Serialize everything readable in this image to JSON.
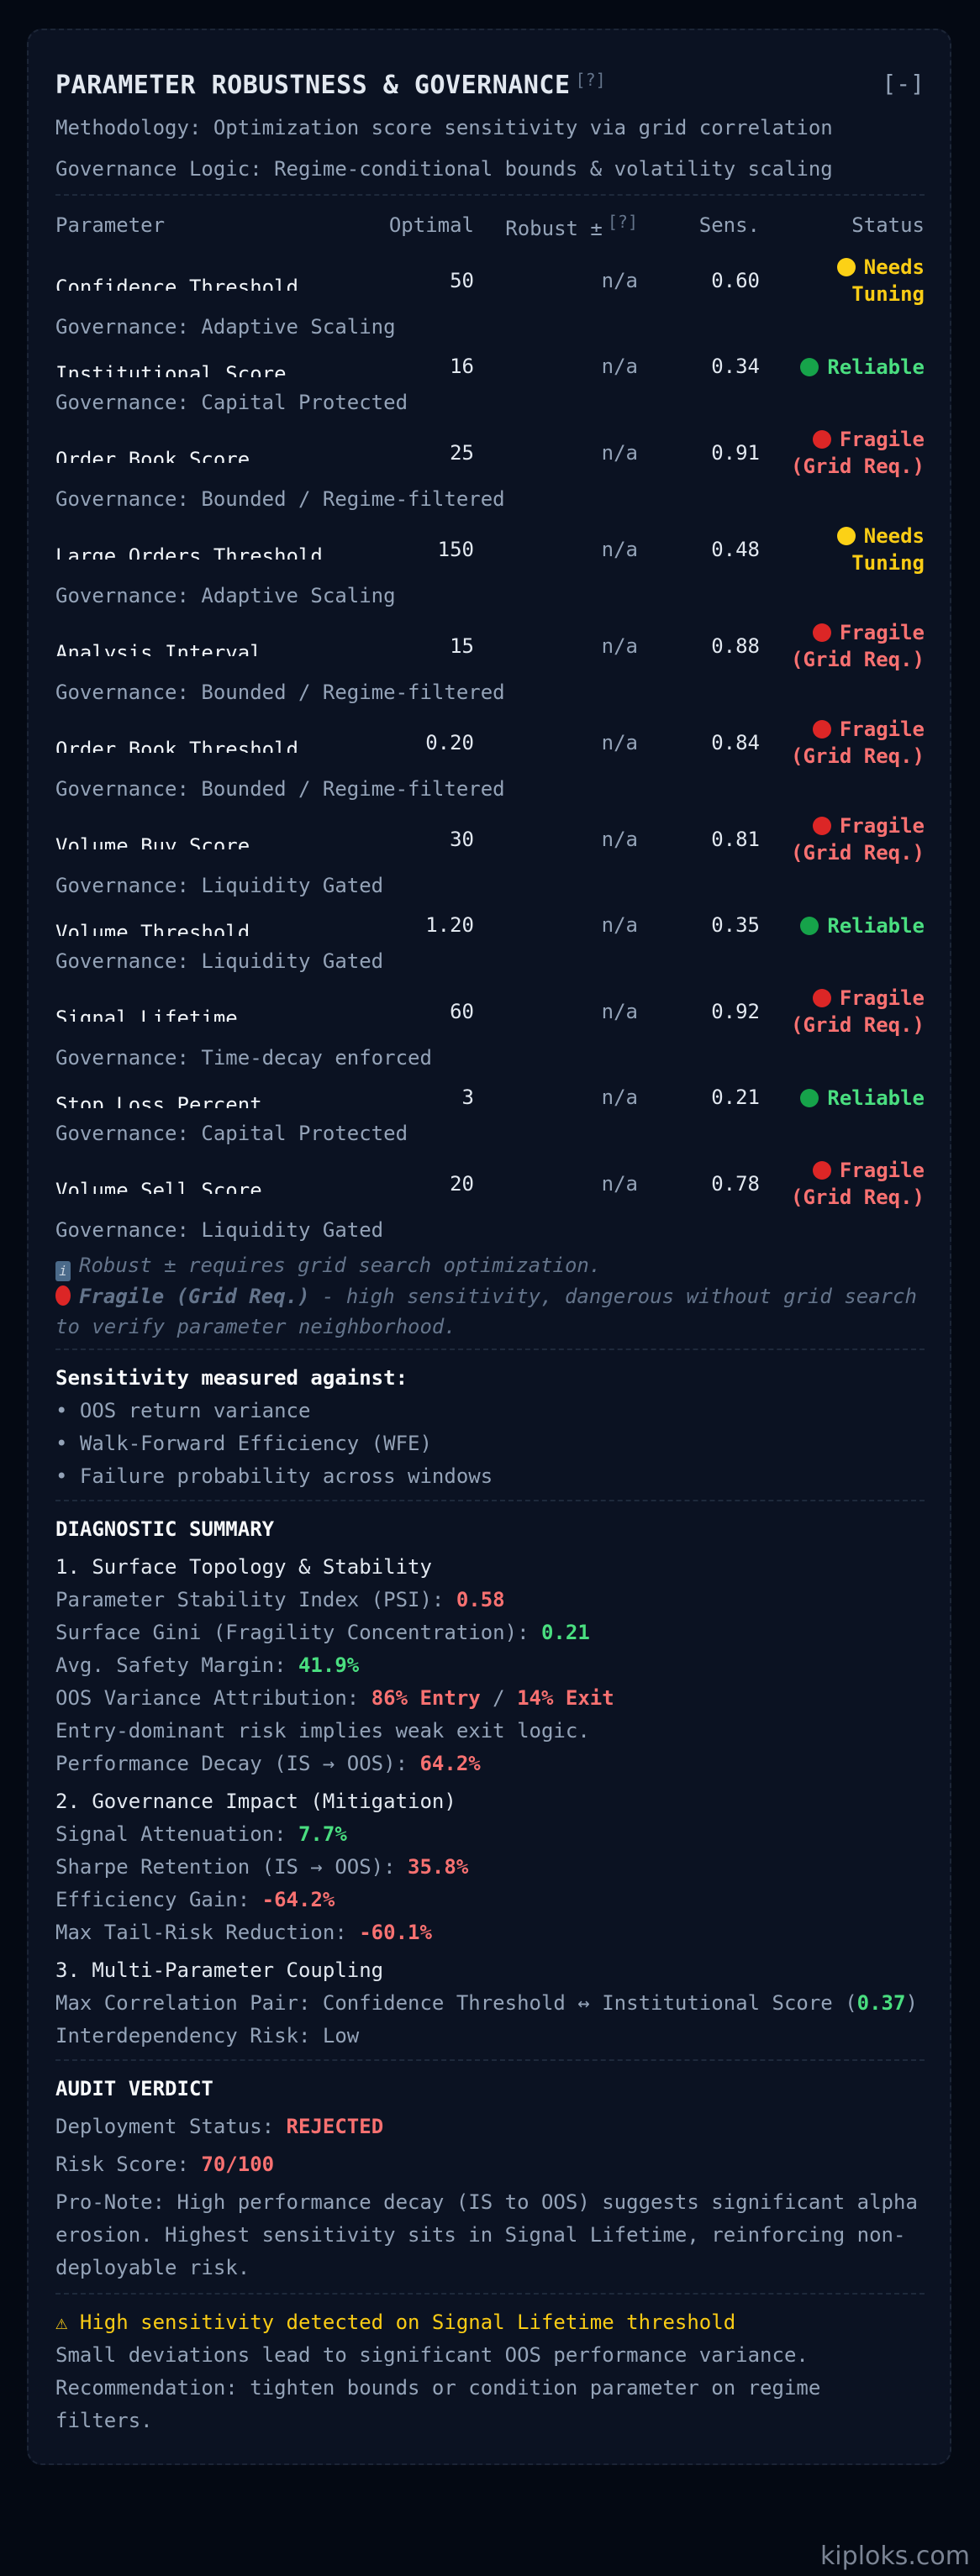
{
  "header": {
    "title": "PARAMETER ROBUSTNESS & GOVERNANCE",
    "help": "[?]",
    "collapse": "[-]"
  },
  "methodology": "Methodology: Optimization score sensitivity via grid correlation",
  "governance_logic": "Governance Logic: Regime-conditional bounds & volatility scaling",
  "table": {
    "headers": {
      "parameter": "Parameter",
      "optimal": "Optimal",
      "robust": "Robust ±",
      "robust_help": "[?]",
      "sens": "Sens.",
      "status": "Status"
    },
    "rows": [
      {
        "name": "Confidence Threshold",
        "optimal": "50",
        "robust": "n/a",
        "sens": "0.60",
        "status": "Needs Tuning",
        "level": "yellow",
        "governance": "Governance: Adaptive Scaling"
      },
      {
        "name": "Institutional Score",
        "optimal": "16",
        "robust": "n/a",
        "sens": "0.34",
        "status": "Reliable",
        "level": "green",
        "governance": "Governance: Capital Protected"
      },
      {
        "name": "Order Book Score",
        "optimal": "25",
        "robust": "n/a",
        "sens": "0.91",
        "status": "Fragile (Grid Req.)",
        "level": "red",
        "governance": "Governance: Bounded / Regime-filtered"
      },
      {
        "name": "Large Orders Threshold",
        "optimal": "150",
        "robust": "n/a",
        "sens": "0.48",
        "status": "Needs Tuning",
        "level": "yellow",
        "governance": "Governance: Adaptive Scaling"
      },
      {
        "name": "Analysis Interval",
        "optimal": "15",
        "robust": "n/a",
        "sens": "0.88",
        "status": "Fragile (Grid Req.)",
        "level": "red",
        "governance": "Governance: Bounded / Regime-filtered"
      },
      {
        "name": "Order Book Threshold",
        "optimal": "0.20",
        "robust": "n/a",
        "sens": "0.84",
        "status": "Fragile (Grid Req.)",
        "level": "red",
        "governance": "Governance: Bounded / Regime-filtered"
      },
      {
        "name": "Volume Buy Score",
        "optimal": "30",
        "robust": "n/a",
        "sens": "0.81",
        "status": "Fragile (Grid Req.)",
        "level": "red",
        "governance": "Governance: Liquidity Gated"
      },
      {
        "name": "Volume Threshold",
        "optimal": "1.20",
        "robust": "n/a",
        "sens": "0.35",
        "status": "Reliable",
        "level": "green",
        "governance": "Governance: Liquidity Gated"
      },
      {
        "name": "Signal Lifetime",
        "optimal": "60",
        "robust": "n/a",
        "sens": "0.92",
        "status": "Fragile (Grid Req.)",
        "level": "red",
        "governance": "Governance: Time-decay enforced"
      },
      {
        "name": "Stop Loss Percent",
        "optimal": "3",
        "robust": "n/a",
        "sens": "0.21",
        "status": "Reliable",
        "level": "green",
        "governance": "Governance: Capital Protected"
      },
      {
        "name": "Volume Sell Score",
        "optimal": "20",
        "robust": "n/a",
        "sens": "0.78",
        "status": "Fragile (Grid Req.)",
        "level": "red",
        "governance": "Governance: Liquidity Gated"
      }
    ]
  },
  "footnotes": {
    "robust_note": "Robust ± requires grid search optimization.",
    "fragile_label": "Fragile (Grid Req.)",
    "fragile_note": " - high sensitivity, dangerous without grid search to verify parameter neighborhood."
  },
  "sensitivity": {
    "title": "Sensitivity measured against:",
    "items": [
      "• OOS return variance",
      "• Walk-Forward Efficiency (WFE)",
      "• Failure probability across windows"
    ]
  },
  "diagnostic": {
    "title": "DIAGNOSTIC SUMMARY",
    "s1": {
      "title": "1. Surface Topology & Stability",
      "psi_label": "Parameter Stability Index (PSI): ",
      "psi": "0.58",
      "gini_label": "Surface Gini (Fragility Concentration): ",
      "gini": "0.21",
      "margin_label": "Avg. Safety Margin: ",
      "margin": "41.9%",
      "oos_label": "OOS Variance Attribution: ",
      "entry": "86% Entry",
      "sep": " / ",
      "exit": "14% Exit",
      "entry_note": "Entry-dominant risk implies weak exit logic.",
      "decay_label": "Performance Decay (IS → OOS): ",
      "decay": "64.2%"
    },
    "s2": {
      "title": "2. Governance Impact (Mitigation)",
      "atten_label": "Signal Attenuation: ",
      "atten": "7.7%",
      "sharpe_label": "Sharpe Retention (IS → OOS): ",
      "sharpe": "35.8%",
      "eff_label": "Efficiency Gain: ",
      "eff": "-64.2%",
      "tail_label": "Max Tail-Risk Reduction: ",
      "tail": "-60.1%"
    },
    "s3": {
      "title": "3. Multi-Parameter Coupling",
      "pair_label": "Max Correlation Pair: Confidence Threshold ↔ Institutional Score (",
      "pair_value": "0.37",
      "pair_close": ")",
      "risk": "Interdependency Risk: Low"
    }
  },
  "verdict": {
    "title": "AUDIT VERDICT",
    "status_label": "Deployment Status: ",
    "status": "REJECTED",
    "risk_label": "Risk Score: ",
    "risk": "70/100",
    "note": "Pro-Note: High performance decay (IS to OOS) suggests significant alpha erosion. Highest sensitivity sits in Signal Lifetime, reinforcing non-deployable risk."
  },
  "warning": {
    "title": "⚠ High sensitivity detected on Signal Lifetime threshold",
    "detail": "Small deviations lead to significant OOS performance variance.",
    "recommendation": "Recommendation: tighten bounds or condition parameter on regime filters."
  },
  "watermark": "kiploks.com",
  "colors": {
    "yellow": "#facc15",
    "green": "#4ade80",
    "red": "#f87171"
  }
}
